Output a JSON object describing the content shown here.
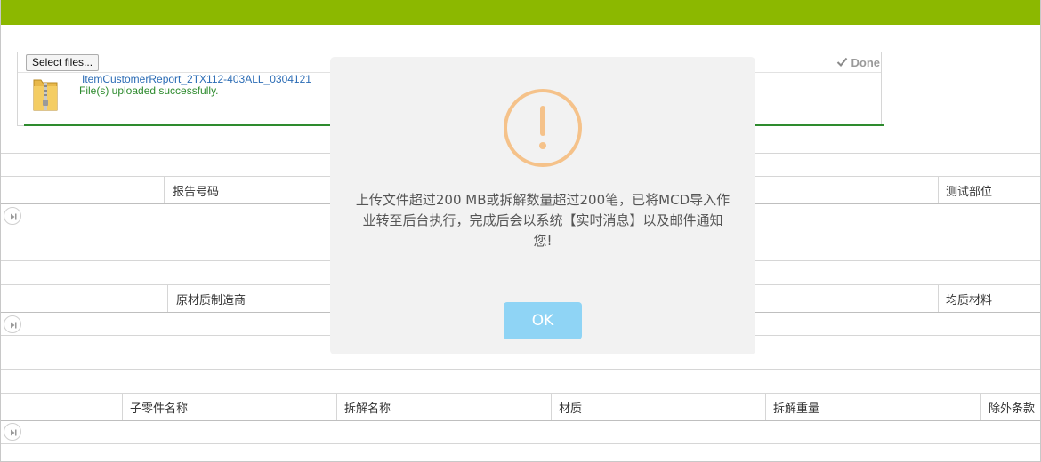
{
  "upload": {
    "select_label": "Select files...",
    "done_label": "Done",
    "file_name": "ItemCustomerReport_2TX112-403ALL_0304121",
    "status": "File(s) uploaded successfully."
  },
  "grids": [
    {
      "headers": [
        "报告号码",
        "测试部位"
      ]
    },
    {
      "headers": [
        "原材质制造商",
        "均质材料"
      ]
    },
    {
      "headers": [
        "子零件名称",
        "拆解名称",
        "材质",
        "拆解重量",
        "除外条款"
      ]
    }
  ],
  "dialog": {
    "message_line1": "上传文件超过200 MB或拆解数量超过200笔，已将MCD导入作",
    "message_line2": "业转至后台执行，完成后会以系统【实时消息】以及邮件通知",
    "message_line3": "您!",
    "ok_label": "OK"
  },
  "colors": {
    "topbar": "#8cb800",
    "success": "#2e8b2e",
    "warning_icon": "#f5c28a",
    "ok_button": "#8fd4f5"
  }
}
